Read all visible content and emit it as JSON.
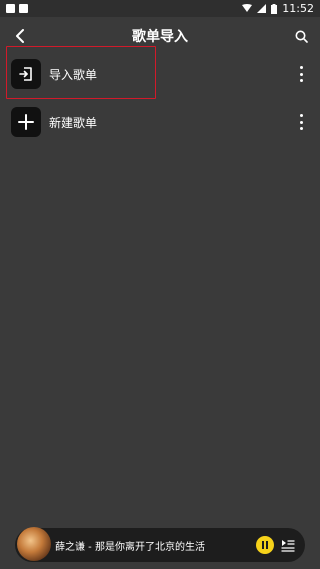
{
  "status_bar": {
    "time": "11:52"
  },
  "header": {
    "title": "歌单导入"
  },
  "list": {
    "items": [
      {
        "label": "导入歌单",
        "icon": "import-icon"
      },
      {
        "label": "新建歌单",
        "icon": "plus-icon"
      }
    ]
  },
  "player": {
    "track": "薛之谦 - 那是你离开了北京的生活"
  },
  "colors": {
    "background": "#3a3a3a",
    "highlight": "#d11a2a",
    "play_button": "#f6d21a"
  }
}
